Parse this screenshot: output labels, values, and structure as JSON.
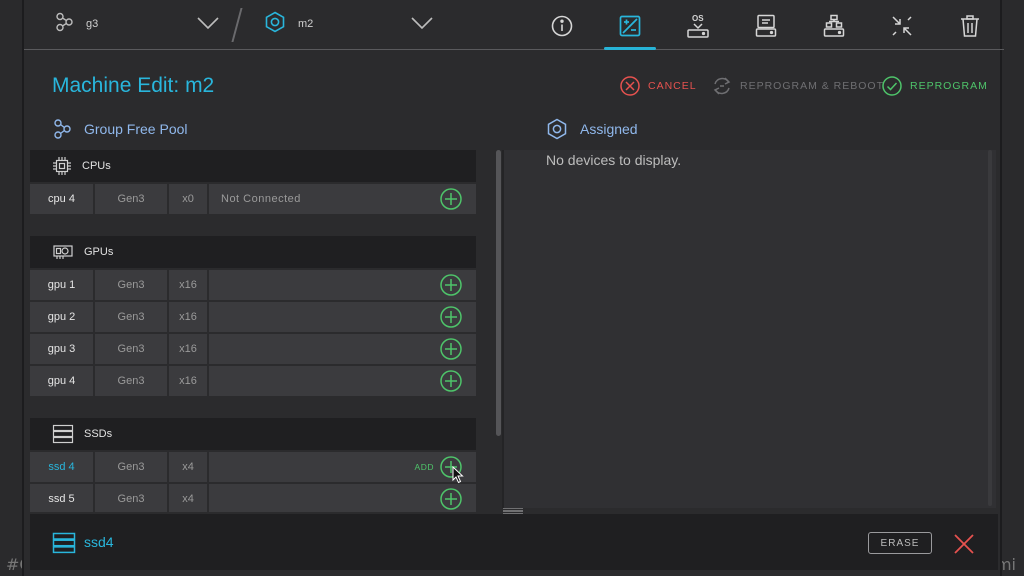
{
  "edges": {
    "left": "#C",
    "right": "mi"
  },
  "topbar": {
    "group_name": "g3",
    "machine_name": "m2",
    "tools": [
      {
        "name": "info-tool",
        "icon": "info-icon"
      },
      {
        "name": "edit-tool",
        "icon": "edit-icon",
        "active": true
      },
      {
        "name": "os-tool",
        "icon": "os-install-icon",
        "label": "OS"
      },
      {
        "name": "disk-tool",
        "icon": "disk-icon"
      },
      {
        "name": "topology-tool",
        "icon": "topology-icon"
      },
      {
        "name": "collapse-tool",
        "icon": "collapse-icon"
      },
      {
        "name": "delete-tool",
        "icon": "trash-icon"
      }
    ]
  },
  "title": "Machine Edit: m2",
  "actions": {
    "cancel": "CANCEL",
    "reboot": "REPROGRAM & REBOOT",
    "reprogram": "REPROGRAM"
  },
  "left": {
    "heading": "Group Free Pool",
    "groups": [
      {
        "label": "CPUs",
        "icon": "cpu-icon",
        "rows": [
          {
            "name": "cpu 4",
            "gen": "Gen3",
            "lanes": "x0",
            "status": "Not Connected"
          }
        ]
      },
      {
        "label": "GPUs",
        "icon": "gpu-icon",
        "rows": [
          {
            "name": "gpu 1",
            "gen": "Gen3",
            "lanes": "x16",
            "status": ""
          },
          {
            "name": "gpu 2",
            "gen": "Gen3",
            "lanes": "x16",
            "status": ""
          },
          {
            "name": "gpu 3",
            "gen": "Gen3",
            "lanes": "x16",
            "status": ""
          },
          {
            "name": "gpu 4",
            "gen": "Gen3",
            "lanes": "x16",
            "status": ""
          }
        ]
      },
      {
        "label": "SSDs",
        "icon": "ssd-icon",
        "rows": [
          {
            "name": "ssd 4",
            "gen": "Gen3",
            "lanes": "x4",
            "status": "",
            "add_label": "ADD",
            "highlight": true
          },
          {
            "name": "ssd 5",
            "gen": "Gen3",
            "lanes": "x4",
            "status": ""
          }
        ]
      }
    ]
  },
  "right": {
    "heading": "Assigned",
    "empty_message": "No devices to display."
  },
  "bottom": {
    "selected": "ssd4",
    "erase": "ERASE"
  },
  "colors": {
    "accent": "#29b6dc",
    "cancel": "#e6524f",
    "reprogram": "#4ec46a",
    "muted": "#6f6f72"
  }
}
